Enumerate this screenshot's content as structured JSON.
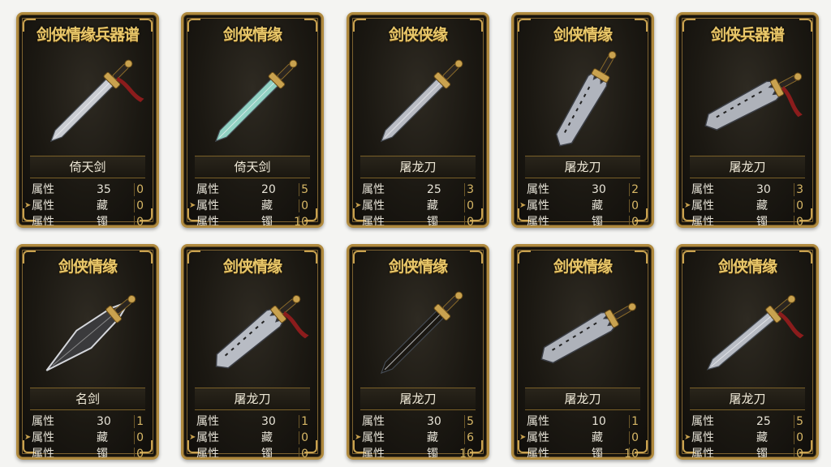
{
  "cards": [
    {
      "title": "剑侠情缘兵器谱",
      "name": "倚天剑",
      "stats": [
        {
          "label": "属性",
          "v1": "35",
          "v2": "0"
        },
        {
          "label": "属性",
          "v1": "藏",
          "v2": "0"
        },
        {
          "label": "属性",
          "v1": "镯",
          "v2": "0"
        }
      ]
    },
    {
      "title": "剑侠情缘",
      "name": "倚天剑",
      "stats": [
        {
          "label": "属性",
          "v1": "20",
          "v2": "5"
        },
        {
          "label": "属性",
          "v1": "藏",
          "v2": "0"
        },
        {
          "label": "属性",
          "v1": "镯",
          "v2": "10"
        }
      ]
    },
    {
      "title": "剑侠侠缘",
      "name": "屠龙刀",
      "stats": [
        {
          "label": "属性",
          "v1": "25",
          "v2": "3"
        },
        {
          "label": "属性",
          "v1": "藏",
          "v2": "0"
        },
        {
          "label": "属性",
          "v1": "镯",
          "v2": "0"
        }
      ]
    },
    {
      "title": "剑侠情缘",
      "name": "屠龙刀",
      "stats": [
        {
          "label": "属性",
          "v1": "30",
          "v2": "2"
        },
        {
          "label": "属性",
          "v1": "藏",
          "v2": "0"
        },
        {
          "label": "属性",
          "v1": "镯",
          "v2": "0"
        }
      ]
    },
    {
      "title": "剑侠兵器谱",
      "name": "屠龙刀",
      "stats": [
        {
          "label": "属性",
          "v1": "30",
          "v2": "3"
        },
        {
          "label": "属性",
          "v1": "藏",
          "v2": "0"
        },
        {
          "label": "属性",
          "v1": "镯",
          "v2": "0"
        }
      ]
    },
    {
      "title": "剑侠情缘",
      "name": "名剑",
      "stats": [
        {
          "label": "属性",
          "v1": "30",
          "v2": "1"
        },
        {
          "label": "属性",
          "v1": "藏",
          "v2": "0"
        },
        {
          "label": "属性",
          "v1": "镯",
          "v2": "0"
        }
      ]
    },
    {
      "title": "剑侠情缘",
      "name": "屠龙刀",
      "stats": [
        {
          "label": "属性",
          "v1": "30",
          "v2": "1"
        },
        {
          "label": "属性",
          "v1": "藏",
          "v2": "0"
        },
        {
          "label": "属性",
          "v1": "镯",
          "v2": "0"
        }
      ]
    },
    {
      "title": "剑侠情缘",
      "name": "屠龙刀",
      "stats": [
        {
          "label": "属性",
          "v1": "30",
          "v2": "5"
        },
        {
          "label": "属性",
          "v1": "藏",
          "v2": "6"
        },
        {
          "label": "属性",
          "v1": "镯",
          "v2": "10"
        }
      ]
    },
    {
      "title": "剑侠情缘",
      "name": "屠龙刀",
      "stats": [
        {
          "label": "属性",
          "v1": "10",
          "v2": "1"
        },
        {
          "label": "属性",
          "v1": "藏",
          "v2": "0"
        },
        {
          "label": "属性",
          "v1": "镯",
          "v2": "10"
        }
      ]
    },
    {
      "title": "剑侠情缘",
      "name": "屠龙刀",
      "stats": [
        {
          "label": "属性",
          "v1": "25",
          "v2": "5"
        },
        {
          "label": "属性",
          "v1": "藏",
          "v2": "0"
        },
        {
          "label": "属性",
          "v1": "镯",
          "v2": "0"
        }
      ]
    }
  ],
  "colors": {
    "frame": "#b08a3e",
    "title": "#e8c76a",
    "text": "#e6e2d6",
    "accent": "#d7b766"
  }
}
